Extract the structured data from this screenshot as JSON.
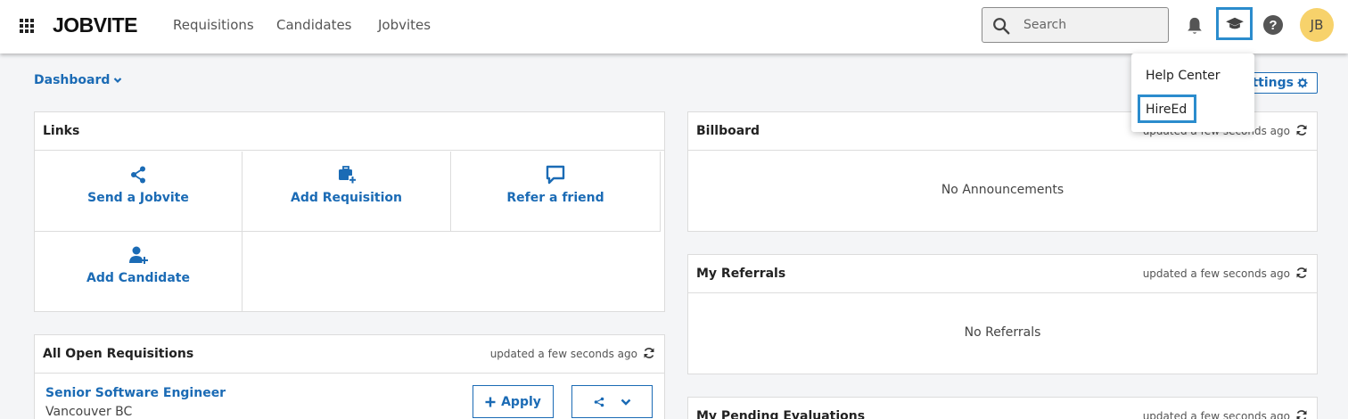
{
  "header": {
    "logo": "JOBVITE",
    "nav": [
      {
        "label": "Requisitions"
      },
      {
        "label": "Candidates"
      },
      {
        "label": "Jobvites"
      }
    ],
    "search": {
      "placeholder": "Search",
      "value": ""
    },
    "avatar_initials": "JB",
    "icons": [
      "apps-grid-icon",
      "search-icon",
      "bell-icon",
      "graduation-cap-icon",
      "help-icon"
    ]
  },
  "dashboard": {
    "label": "Dashboard",
    "settings_label": "Settings"
  },
  "dropdown": {
    "items": [
      {
        "label": "Help Center"
      },
      {
        "label": "HireEd"
      }
    ]
  },
  "links_panel": {
    "title": "Links",
    "items": [
      {
        "label": "Send a Jobvite",
        "icon": "share-icon"
      },
      {
        "label": "Add Requisition",
        "icon": "briefcase-plus-icon"
      },
      {
        "label": "Refer a friend",
        "icon": "chat-icon"
      },
      {
        "label": "Add Candidate",
        "icon": "user-plus-icon"
      }
    ]
  },
  "billboard": {
    "title": "Billboard",
    "updated": "updated a few seconds ago",
    "empty": "No Announcements"
  },
  "referrals": {
    "title": "My Referrals",
    "updated": "updated a few seconds ago",
    "empty": "No Referrals"
  },
  "evaluations": {
    "title": "My Pending Evaluations",
    "updated": "updated a few seconds ago"
  },
  "requisitions": {
    "title": "All Open Requisitions",
    "updated": "updated a few seconds ago",
    "rows": [
      {
        "title": "Senior Software Engineer",
        "location": "Vancouver BC",
        "apply_label": "Apply"
      }
    ]
  },
  "colors": {
    "accent": "#1b6bb5",
    "highlight": "#2b8ccd",
    "avatar_bg": "#f7d26b"
  }
}
